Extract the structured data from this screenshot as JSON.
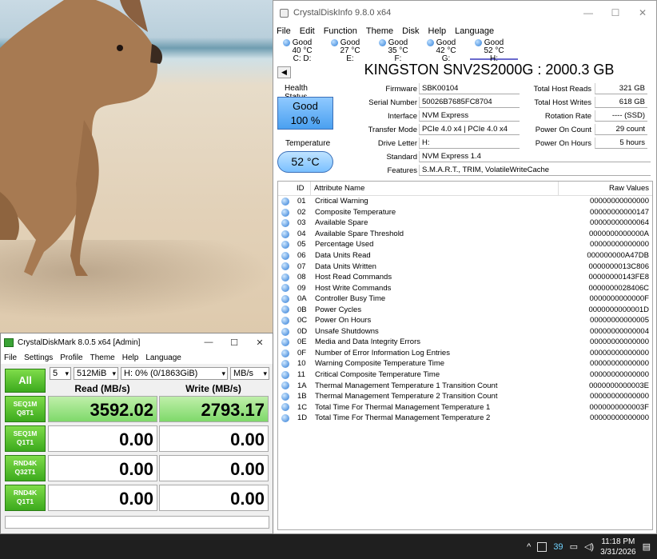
{
  "cdi": {
    "title": "CrystalDiskInfo 9.8.0 x64",
    "menu": [
      "File",
      "Edit",
      "Function",
      "Theme",
      "Disk",
      "Help",
      "Language"
    ],
    "drives": [
      {
        "status": "Good",
        "temp": "40 °C",
        "letter": "C: D:"
      },
      {
        "status": "Good",
        "temp": "27 °C",
        "letter": "E:"
      },
      {
        "status": "Good",
        "temp": "35 °C",
        "letter": "F:"
      },
      {
        "status": "Good",
        "temp": "42 °C",
        "letter": "G:"
      },
      {
        "status": "Good",
        "temp": "52 °C",
        "letter": "H:"
      }
    ],
    "model": "KINGSTON SNV2S2000G : 2000.3 GB",
    "health_label": "Health Status",
    "health_status": "Good",
    "health_percent": "100 %",
    "temp_label": "Temperature",
    "temp_value": "52 °C",
    "fields": {
      "firmware_label": "Firmware",
      "firmware": "SBK00104",
      "serial_label": "Serial Number",
      "serial": "50026B7685FC8704",
      "interface_label": "Interface",
      "interface": "NVM Express",
      "transfer_label": "Transfer Mode",
      "transfer": "PCIe 4.0 x4 | PCIe 4.0 x4",
      "letter_label": "Drive Letter",
      "letter": "H:",
      "standard_label": "Standard",
      "standard": "NVM Express 1.4",
      "features_label": "Features",
      "features": "S.M.A.R.T., TRIM, VolatileWriteCache"
    },
    "right": {
      "reads_label": "Total Host Reads",
      "reads": "321 GB",
      "writes_label": "Total Host Writes",
      "writes": "618 GB",
      "rotation_label": "Rotation Rate",
      "rotation": "---- (SSD)",
      "power_count_label": "Power On Count",
      "power_count": "29 count",
      "power_hours_label": "Power On Hours",
      "power_hours": "5 hours"
    },
    "table_headers": {
      "id": "ID",
      "name": "Attribute Name",
      "raw": "Raw Values"
    },
    "attributes": [
      {
        "id": "01",
        "name": "Critical Warning",
        "raw": "00000000000000"
      },
      {
        "id": "02",
        "name": "Composite Temperature",
        "raw": "00000000000147"
      },
      {
        "id": "03",
        "name": "Available Spare",
        "raw": "00000000000064"
      },
      {
        "id": "04",
        "name": "Available Spare Threshold",
        "raw": "0000000000000A"
      },
      {
        "id": "05",
        "name": "Percentage Used",
        "raw": "00000000000000"
      },
      {
        "id": "06",
        "name": "Data Units Read",
        "raw": "000000000A47DB"
      },
      {
        "id": "07",
        "name": "Data Units Written",
        "raw": "0000000013C806"
      },
      {
        "id": "08",
        "name": "Host Read Commands",
        "raw": "00000000143FE8"
      },
      {
        "id": "09",
        "name": "Host Write Commands",
        "raw": "0000000028406C"
      },
      {
        "id": "0A",
        "name": "Controller Busy Time",
        "raw": "0000000000000F"
      },
      {
        "id": "0B",
        "name": "Power Cycles",
        "raw": "0000000000001D"
      },
      {
        "id": "0C",
        "name": "Power On Hours",
        "raw": "00000000000005"
      },
      {
        "id": "0D",
        "name": "Unsafe Shutdowns",
        "raw": "00000000000004"
      },
      {
        "id": "0E",
        "name": "Media and Data Integrity Errors",
        "raw": "00000000000000"
      },
      {
        "id": "0F",
        "name": "Number of Error Information Log Entries",
        "raw": "00000000000000"
      },
      {
        "id": "10",
        "name": "Warning Composite Temperature Time",
        "raw": "00000000000000"
      },
      {
        "id": "11",
        "name": "Critical Composite Temperature Time",
        "raw": "00000000000000"
      },
      {
        "id": "1A",
        "name": "Thermal Management Temperature 1 Transition Count",
        "raw": "0000000000003E"
      },
      {
        "id": "1B",
        "name": "Thermal Management Temperature 2 Transition Count",
        "raw": "00000000000000"
      },
      {
        "id": "1C",
        "name": "Total Time For Thermal Management Temperature 1",
        "raw": "0000000000003F"
      },
      {
        "id": "1D",
        "name": "Total Time For Thermal Management Temperature 2",
        "raw": "00000000000000"
      }
    ]
  },
  "cdm": {
    "title": "CrystalDiskMark 8.0.5 x64 [Admin]",
    "menu": [
      "File",
      "Settings",
      "Profile",
      "Theme",
      "Help",
      "Language"
    ],
    "all_label": "All",
    "count": "5",
    "size": "512MiB",
    "drive": "H: 0% (0/1863GiB)",
    "unit": "MB/s",
    "read_header": "Read (MB/s)",
    "write_header": "Write (MB/s)",
    "tests": [
      {
        "line1": "SEQ1M",
        "line2": "Q8T1",
        "read": "3592.02",
        "write": "2793.17"
      },
      {
        "line1": "SEQ1M",
        "line2": "Q1T1",
        "read": "0.00",
        "write": "0.00"
      },
      {
        "line1": "RND4K",
        "line2": "Q32T1",
        "read": "0.00",
        "write": "0.00"
      },
      {
        "line1": "RND4K",
        "line2": "Q1T1",
        "read": "0.00",
        "write": "0.00"
      }
    ]
  },
  "taskbar": {
    "badge": "39",
    "time": "11:18 PM",
    "date": "3/31/2026"
  }
}
